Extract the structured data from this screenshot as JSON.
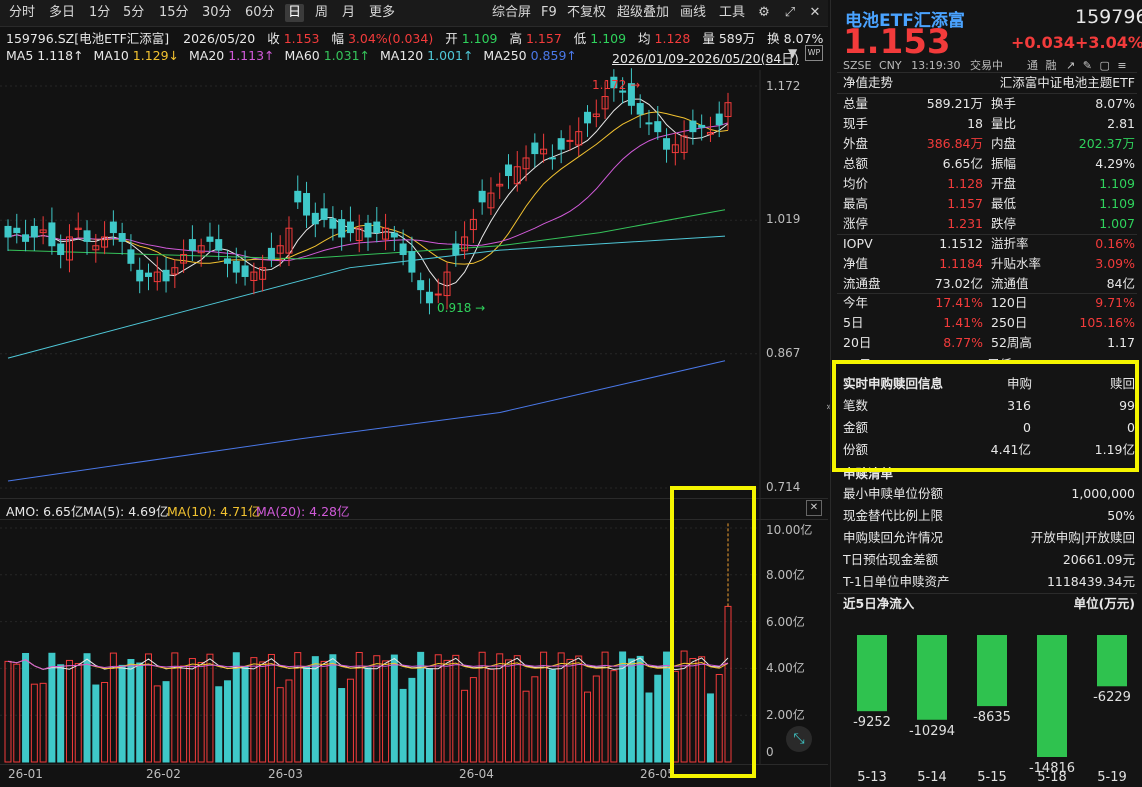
{
  "toolbar": {
    "periods": [
      "分时",
      "多日",
      "1分",
      "5分",
      "15分",
      "30分",
      "60分",
      "日",
      "周",
      "月",
      "更多"
    ],
    "active": "日",
    "tools": [
      "综合屏",
      "F9",
      "不复权",
      "超级叠加",
      "画线",
      "工具"
    ],
    "settings_icon": "gear-icon",
    "fullscreen_icon": "expand-icon"
  },
  "header": {
    "code_name": "159796.SZ[电池ETF汇添富]",
    "date": "2026/05/20",
    "close_label": "收",
    "close_value": "1.153",
    "amp_label": "幅",
    "amp_value": "3.04%(0.034)",
    "open_label": "开",
    "open_value": "1.109",
    "high_label": "高",
    "high_value": "1.157",
    "low_label": "低",
    "low_value": "1.109",
    "avg_label": "均",
    "avg_value": "1.128",
    "vol_label": "量",
    "vol_value": "589万",
    "turn_label": "换",
    "turn_value": "8.07%",
    "range": "2026/01/09-2026/05/20(84日)"
  },
  "ma_legend": [
    {
      "label": "MA5",
      "value": "1.118↑",
      "color": "#e8e8e8"
    },
    {
      "label": "MA10",
      "value": "1.129↓",
      "color": "#f2c230"
    },
    {
      "label": "MA20",
      "value": "1.113↑",
      "color": "#d05ad8"
    },
    {
      "label": "MA60",
      "value": "1.031↑",
      "color": "#35c25a"
    },
    {
      "label": "MA120",
      "value": "1.001↑",
      "color": "#4fc8d8"
    },
    {
      "label": "MA250",
      "value": "0.859↑",
      "color": "#4a78e8"
    }
  ],
  "price_axis": [
    "1.172",
    "1.019",
    "0.867",
    "0.714"
  ],
  "annotations": {
    "high": "1.172",
    "low": "0.918"
  },
  "amo_legend": {
    "amo": "AMO: 6.65亿",
    "ma5": "MA(5): 4.69亿",
    "ma10": "MA(10): 4.71亿",
    "ma20": "MA(20): 4.28亿"
  },
  "vol_axis": [
    "10.00亿",
    "8.00亿",
    "6.00亿",
    "4.00亿",
    "2.00亿",
    "0"
  ],
  "x_axis": [
    "26-01",
    "26-02",
    "26-03",
    "26-04",
    "26-05"
  ],
  "chart_data": {
    "type": "candlestick",
    "price_ylim": [
      0.714,
      1.172
    ],
    "close_series_approx": [
      1.0,
      1.005,
      0.995,
      1.0,
      1.008,
      0.99,
      0.98,
      1.0,
      1.01,
      0.995,
      0.99,
      1.0,
      1.005,
      0.995,
      0.97,
      0.95,
      0.955,
      0.96,
      0.95,
      0.965,
      0.98,
      0.985,
      0.99,
      0.995,
      0.985,
      0.97,
      0.96,
      0.955,
      0.96,
      0.965,
      0.975,
      0.99,
      1.01,
      1.04,
      1.025,
      1.015,
      1.02,
      1.01,
      1.0,
      1.005,
      1.01,
      1.0,
      1.005,
      1.01,
      1.0,
      0.98,
      0.96,
      0.94,
      0.925,
      0.935,
      0.96,
      0.98,
      1.0,
      1.02,
      1.04,
      1.05,
      1.06,
      1.07,
      1.08,
      1.09,
      1.095,
      1.1,
      1.09,
      1.1,
      1.11,
      1.12,
      1.13,
      1.14,
      1.16,
      1.17,
      1.165,
      1.15,
      1.14,
      1.13,
      1.12,
      1.1,
      1.105,
      1.115,
      1.12,
      1.125,
      1.119,
      1.128,
      1.153
    ],
    "volume_ylim": [
      0,
      10.0
    ],
    "volume_unit": "亿",
    "amo_last": 6.65
  },
  "quote": {
    "title": "电池ETF汇添富",
    "code": "159796",
    "price": "1.153",
    "change": "+0.034",
    "change_pct": "+3.04%",
    "exchange": "SZSE",
    "currency": "CNY",
    "time": "13:19:30",
    "status": "交易中",
    "flags": [
      "通",
      "融"
    ]
  },
  "nav_row": {
    "left": "净值走势",
    "right": "汇添富中证电池主题ETF"
  },
  "stats": [
    [
      {
        "k": "总量",
        "v": "589.21万",
        "c": "wh"
      },
      {
        "k": "换手",
        "v": "8.07%",
        "c": "wh"
      }
    ],
    [
      {
        "k": "现手",
        "v": "18",
        "c": "wh"
      },
      {
        "k": "量比",
        "v": "2.81",
        "c": "wh"
      }
    ],
    [
      {
        "k": "外盘",
        "v": "386.84万",
        "c": "up"
      },
      {
        "k": "内盘",
        "v": "202.37万",
        "c": "dn"
      }
    ],
    [
      {
        "k": "总额",
        "v": "6.65亿",
        "c": "wh"
      },
      {
        "k": "振幅",
        "v": "4.29%",
        "c": "wh"
      }
    ],
    [
      {
        "k": "均价",
        "v": "1.128",
        "c": "up"
      },
      {
        "k": "开盘",
        "v": "1.109",
        "c": "dn"
      }
    ],
    [
      {
        "k": "最高",
        "v": "1.157",
        "c": "up"
      },
      {
        "k": "最低",
        "v": "1.109",
        "c": "dn"
      }
    ],
    [
      {
        "k": "涨停",
        "v": "1.231",
        "c": "up"
      },
      {
        "k": "跌停",
        "v": "1.007",
        "c": "dn"
      }
    ]
  ],
  "stats2": [
    [
      {
        "k": "IOPV",
        "v": "1.1512",
        "c": "wh"
      },
      {
        "k": "溢折率",
        "v": "0.16%",
        "c": "up"
      }
    ],
    [
      {
        "k": "净值",
        "v": "1.1184",
        "c": "up"
      },
      {
        "k": "升贴水率",
        "v": "3.09%",
        "c": "up"
      }
    ],
    [
      {
        "k": "流通盘",
        "v": "73.02亿",
        "c": "wh"
      },
      {
        "k": "流通值",
        "v": "84亿",
        "c": "wh"
      }
    ]
  ],
  "stats3": [
    [
      {
        "k": "今年",
        "v": "17.41%",
        "c": "up"
      },
      {
        "k": "120日",
        "v": "9.71%",
        "c": "up"
      }
    ],
    [
      {
        "k": "5日",
        "v": "1.41%",
        "c": "up"
      },
      {
        "k": "250日",
        "v": "105.16%",
        "c": "up"
      }
    ],
    [
      {
        "k": "20日",
        "v": "8.77%",
        "c": "up"
      },
      {
        "k": "52周高",
        "v": "1.17",
        "c": "wh"
      }
    ]
  ],
  "subscription": {
    "title": "实时申购赎回信息",
    "col1": "申购",
    "col2": "赎回",
    "rows": [
      {
        "k": "笔数",
        "a": "316",
        "b": "99"
      },
      {
        "k": "金额",
        "a": "0",
        "b": "0"
      },
      {
        "k": "份额",
        "a": "4.41亿",
        "b": "1.19亿"
      }
    ]
  },
  "list_section": {
    "title": "申赎清单",
    "rows": [
      {
        "k": "最小申赎单位份额",
        "v": "1,000,000"
      },
      {
        "k": "现金替代比例上限",
        "v": "50%"
      },
      {
        "k": "申购赎回允许情况",
        "v": "开放申购|开放赎回"
      },
      {
        "k": "T日预估现金差额",
        "v": "20661.09元"
      },
      {
        "k": "T-1日单位申赎资产",
        "v": "1118439.34元"
      }
    ]
  },
  "flow": {
    "title": "近5日净流入",
    "unit": "单位(万元)",
    "dates": [
      "5-13",
      "5-14",
      "5-15",
      "5-18",
      "5-19"
    ],
    "values": [
      -9252,
      -10294,
      -8635,
      -14816,
      -6229
    ],
    "labels": [
      "-9252",
      "-10294",
      "-8635",
      "-14816",
      "-6229"
    ]
  },
  "colors": {
    "up": "#f23b3b",
    "down": "#3fc8c8",
    "highlight": "#f5f500",
    "flow": "#2fc24f"
  }
}
